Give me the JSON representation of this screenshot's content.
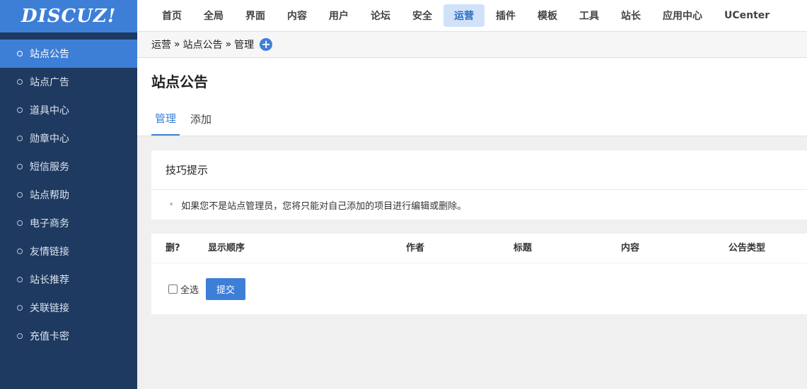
{
  "logo": {
    "text": "DISCUZ!"
  },
  "topnav": {
    "items": [
      "首页",
      "全局",
      "界面",
      "内容",
      "用户",
      "论坛",
      "安全",
      "运营",
      "插件",
      "模板",
      "工具",
      "站长",
      "应用中心",
      "UCenter"
    ],
    "active": "运营"
  },
  "sidebar": {
    "items": [
      "站点公告",
      "站点广告",
      "道具中心",
      "勋章中心",
      "短信服务",
      "站点帮助",
      "电子商务",
      "友情链接",
      "站长推荐",
      "关联链接",
      "充值卡密"
    ],
    "active": "站点公告"
  },
  "breadcrumb": {
    "parts": [
      "运营",
      "站点公告",
      "管理"
    ],
    "separator": "»"
  },
  "page": {
    "title": "站点公告"
  },
  "tabs": {
    "items": [
      "管理",
      "添加"
    ],
    "active": "管理"
  },
  "tips": {
    "title": "技巧提示",
    "items": [
      "如果您不是站点管理员，您将只能对自己添加的项目进行编辑或删除。"
    ]
  },
  "table": {
    "columns": [
      "删?",
      "显示顺序",
      "作者",
      "标题",
      "内容",
      "公告类型"
    ],
    "select_all_label": "全选",
    "submit_label": "提交"
  },
  "colors": {
    "accent": "#3d7fd7",
    "sidebar_bg": "#1f3a60",
    "nav_active_bg": "#d0e2fa"
  },
  "icons": {
    "add": "plus-circle-icon",
    "sidebar_bullet": "circle-outline-icon"
  }
}
